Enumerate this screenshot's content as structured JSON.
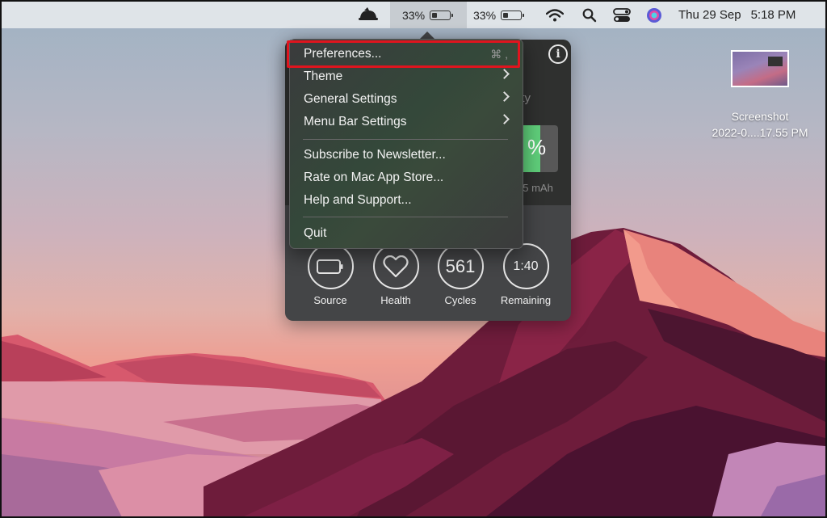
{
  "menubar": {
    "battery_app_percent": "33%",
    "system_battery_percent": "33%",
    "date": "Thu 29 Sep",
    "time": "5:18 PM"
  },
  "menu": {
    "items": [
      {
        "label": "Preferences...",
        "shortcut": "⌘ ,"
      },
      {
        "label": "Theme",
        "submenu": true
      },
      {
        "label": "General Settings",
        "submenu": true
      },
      {
        "label": "Menu Bar Settings",
        "submenu": true
      },
      {
        "label": "Subscribe to Newsletter..."
      },
      {
        "label": "Rate on Mac App Store..."
      },
      {
        "label": "Help and Support..."
      },
      {
        "label": "Quit"
      }
    ]
  },
  "popover": {
    "capacity_partial": "ity",
    "percent_partial": "%",
    "mah_partial": "55 mAh",
    "stats": [
      {
        "label": "Source",
        "value": "",
        "icon": "battery-outline-icon"
      },
      {
        "label": "Health",
        "value": "",
        "icon": "heart-icon"
      },
      {
        "label": "Cycles",
        "value": "561"
      },
      {
        "label": "Remaining",
        "value": "1:40"
      }
    ]
  },
  "desktop_file": {
    "name_line1": "Screenshot",
    "name_line2": "2022-0....17.55 PM"
  },
  "colors": {
    "highlight": "#e0141e",
    "capacity_fill": "#5fce7a"
  }
}
